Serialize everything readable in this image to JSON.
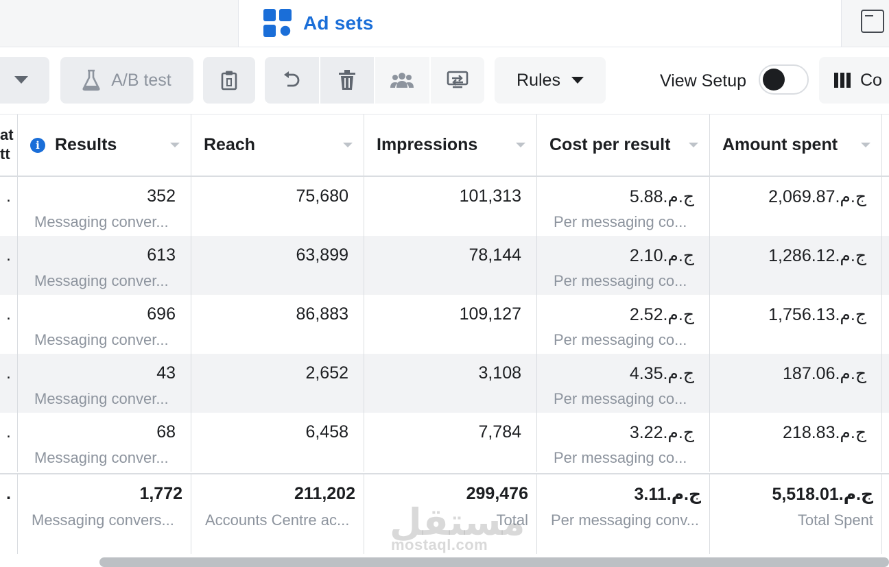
{
  "tabs": {
    "active_title": "Ad sets"
  },
  "toolbar": {
    "ab_test_label": "A/B test",
    "rules_label": "Rules",
    "view_setup_label": "View Setup",
    "view_setup_on": false,
    "columns_label": "Co"
  },
  "table": {
    "stub_header": "at\ntt",
    "headers": {
      "results": "Results",
      "reach": "Reach",
      "impressions": "Impressions",
      "cost_per_result": "Cost per result",
      "amount_spent": "Amount spent"
    },
    "rows": [
      {
        "stub": ".",
        "results": "352",
        "results_sub": "Messaging conver...",
        "reach": "75,680",
        "impressions": "101,313",
        "cost": "ج.م.5.88",
        "cost_sub": "Per messaging co...",
        "spent": "ج.م.2,069.87"
      },
      {
        "stub": ".",
        "results": "613",
        "results_sub": "Messaging conver...",
        "reach": "63,899",
        "impressions": "78,144",
        "cost": "ج.م.2.10",
        "cost_sub": "Per messaging co...",
        "spent": "ج.م.1,286.12"
      },
      {
        "stub": ".",
        "results": "696",
        "results_sub": "Messaging conver...",
        "reach": "86,883",
        "impressions": "109,127",
        "cost": "ج.م.2.52",
        "cost_sub": "Per messaging co...",
        "spent": "ج.م.1,756.13"
      },
      {
        "stub": ".",
        "results": "43",
        "results_sub": "Messaging conver...",
        "reach": "2,652",
        "impressions": "3,108",
        "cost": "ج.م.4.35",
        "cost_sub": "Per messaging co...",
        "spent": "ج.م.187.06"
      },
      {
        "stub": ".",
        "results": "68",
        "results_sub": "Messaging conver...",
        "reach": "6,458",
        "impressions": "7,784",
        "cost": "ج.م.3.22",
        "cost_sub": "Per messaging co...",
        "spent": "ج.م.218.83"
      }
    ],
    "total": {
      "stub": ".",
      "results": "1,772",
      "results_sub": "Messaging convers...",
      "reach": "211,202",
      "reach_sub": "Accounts Centre ac...",
      "impressions": "299,476",
      "impressions_sub": "Total",
      "cost": "ج.م.3.11",
      "cost_sub": "Per messaging conv...",
      "spent": "ج.م.5,518.01",
      "spent_sub": "Total Spent"
    }
  },
  "watermark": {
    "arabic": "مستقل",
    "latin": "mostaql.com"
  },
  "colors": {
    "accent": "#1a6ed8",
    "button_bg": "#ebedf0",
    "row_alt": "#f2f3f5",
    "muted_text": "#8d949e"
  },
  "icons": [
    "chevron-down-icon",
    "flask-icon",
    "clipboard-icon",
    "undo-icon",
    "trash-icon",
    "people-icon",
    "export-icon",
    "caret-down-icon",
    "columns-icon",
    "info-icon",
    "grid-icon",
    "window-icon"
  ]
}
